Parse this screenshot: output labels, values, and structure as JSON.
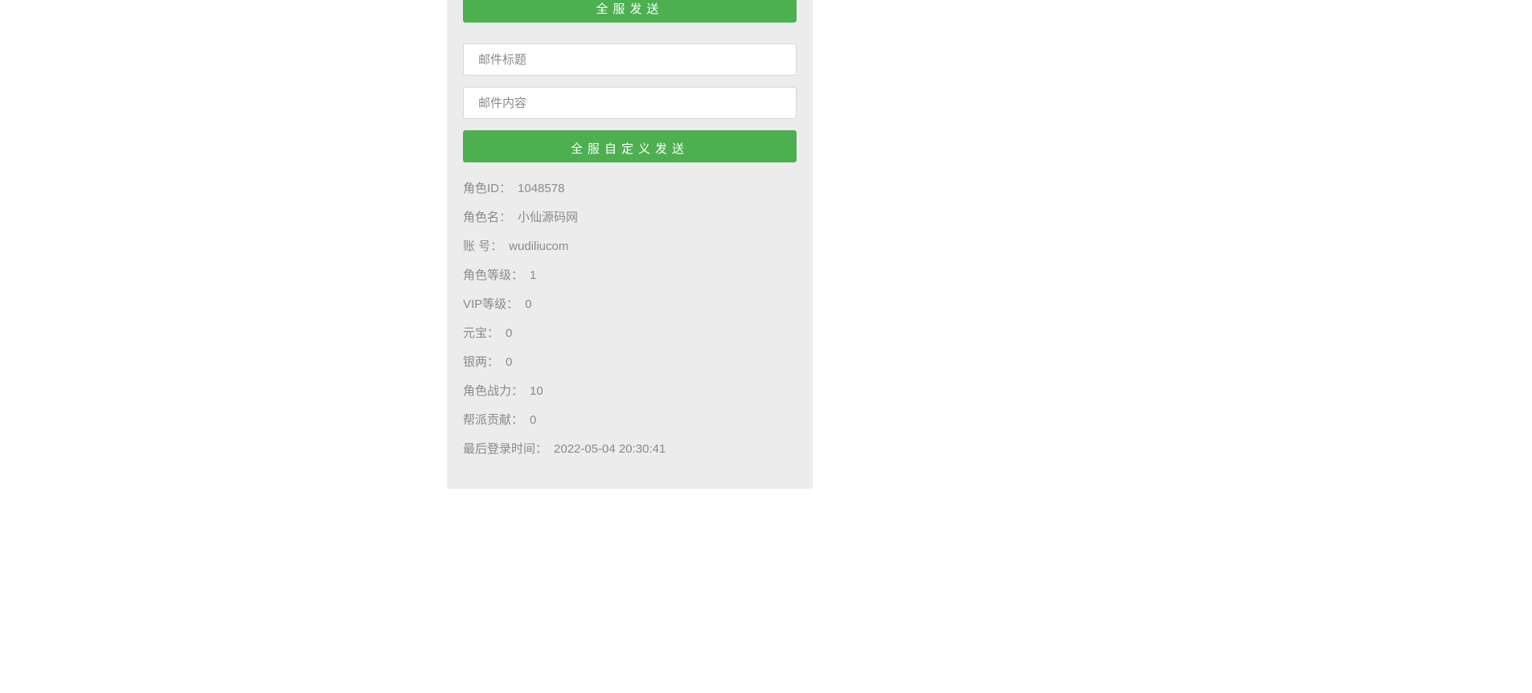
{
  "buttons": {
    "top_send": "全服发送",
    "custom_send": "全服自定义发送"
  },
  "inputs": {
    "title_placeholder": "邮件标题",
    "content_placeholder": "邮件内容"
  },
  "info": {
    "role_id_label": "角色ID：",
    "role_id_value": "1048578",
    "role_name_label": "角色名：",
    "role_name_value": "小仙源码网",
    "account_label": "账 号：",
    "account_value": "wudiliucom",
    "role_level_label": "角色等级：",
    "role_level_value": "1",
    "vip_level_label": "VIP等级：",
    "vip_level_value": "0",
    "yuanbao_label": "元宝：",
    "yuanbao_value": "0",
    "silver_label": "银两：",
    "silver_value": "0",
    "power_label": "角色战力：",
    "power_value": "10",
    "guild_label": "帮派贡献：",
    "guild_value": "0",
    "last_login_label": "最后登录时间：",
    "last_login_value": "2022-05-04 20:30:41"
  }
}
